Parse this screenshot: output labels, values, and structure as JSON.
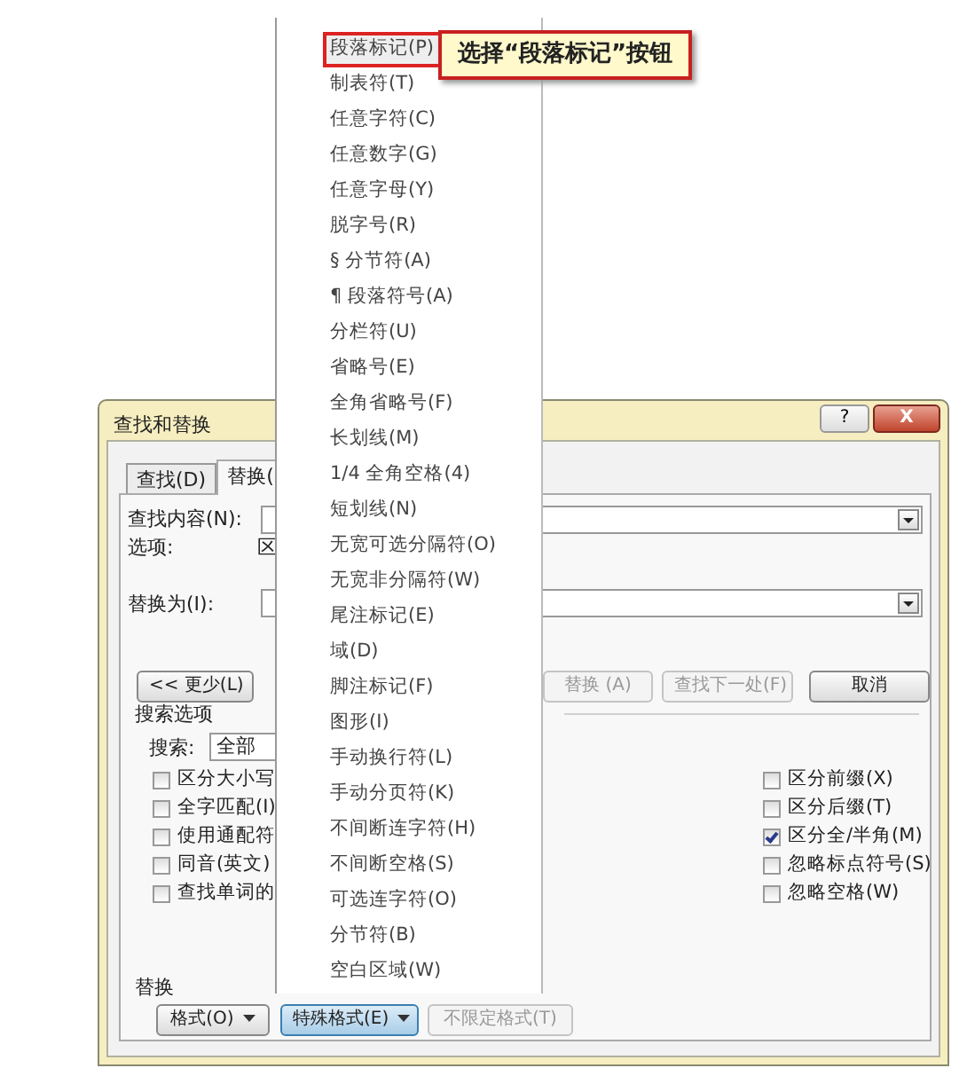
{
  "callout": {
    "text": "选择“段落标记”按钮"
  },
  "special_menu": {
    "items": [
      {
        "label": "段落标记(P)",
        "selected": true
      },
      {
        "label": "制表符(T)",
        "selected": false
      },
      {
        "label": "任意字符(C)",
        "selected": false
      },
      {
        "label": "任意数字(G)",
        "selected": false
      },
      {
        "label": "任意字母(Y)",
        "selected": false
      },
      {
        "label": "脱字号(R)",
        "selected": false
      },
      {
        "label": "§ 分节符(A)",
        "selected": false
      },
      {
        "label": "¶ 段落符号(A)",
        "selected": false
      },
      {
        "label": "分栏符(U)",
        "selected": false
      },
      {
        "label": "省略号(E)",
        "selected": false
      },
      {
        "label": "全角省略号(F)",
        "selected": false
      },
      {
        "label": "长划线(M)",
        "selected": false
      },
      {
        "label": "1/4 全角空格(4)",
        "selected": false
      },
      {
        "label": "短划线(N)",
        "selected": false
      },
      {
        "label": "无宽可选分隔符(O)",
        "selected": false
      },
      {
        "label": "无宽非分隔符(W)",
        "selected": false
      },
      {
        "label": "尾注标记(E)",
        "selected": false
      },
      {
        "label": "域(D)",
        "selected": false
      },
      {
        "label": "脚注标记(F)",
        "selected": false
      },
      {
        "label": "图形(I)",
        "selected": false
      },
      {
        "label": "手动换行符(L)",
        "selected": false
      },
      {
        "label": "手动分页符(K)",
        "selected": false
      },
      {
        "label": "不间断连字符(H)",
        "selected": false
      },
      {
        "label": "不间断空格(S)",
        "selected": false
      },
      {
        "label": "可选连字符(O)",
        "selected": false
      },
      {
        "label": "分节符(B)",
        "selected": false
      },
      {
        "label": "空白区域(W)",
        "selected": false
      }
    ]
  },
  "dialog": {
    "title": "查找和替换",
    "help_button": "?",
    "close_button": "X",
    "tabs": [
      {
        "label": "查找(D)",
        "selected": false
      },
      {
        "label": "替换(",
        "selected": true
      }
    ],
    "find_label": "查找内容(N):",
    "options_label": "选项:",
    "options_value": "区",
    "replace_label": "替换为(I):",
    "less_button": "<< 更少(L)",
    "action_buttons": [
      {
        "label": "替换 (A)",
        "disabled": true
      },
      {
        "label": "查找下一处(F)",
        "disabled": true
      },
      {
        "label": "取消",
        "disabled": false
      }
    ],
    "search_options": {
      "heading": "搜索选项",
      "search_label": "搜索:",
      "search_value": "全部",
      "left_checks": [
        {
          "label": "区分大小写",
          "checked": false
        },
        {
          "label": "全字匹配(I)",
          "checked": false
        },
        {
          "label": "使用通配符",
          "checked": false
        },
        {
          "label": "同音(英文)",
          "checked": false
        },
        {
          "label": "查找单词的",
          "checked": false
        }
      ],
      "right_checks": [
        {
          "label": "区分前缀(X)",
          "checked": false
        },
        {
          "label": "区分后缀(T)",
          "checked": false
        },
        {
          "label": "区分全/半角(M)",
          "checked": true
        },
        {
          "label": "忽略标点符号(S)",
          "checked": false
        },
        {
          "label": "忽略空格(W)",
          "checked": false
        }
      ]
    },
    "replace_section": {
      "heading": "替换",
      "buttons": [
        {
          "label": "格式(O)",
          "dropdown": true,
          "pressed": false,
          "disabled": false
        },
        {
          "label": "特殊格式(E)",
          "dropdown": true,
          "pressed": true,
          "disabled": false
        },
        {
          "label": "不限定格式(T)",
          "dropdown": false,
          "pressed": false,
          "disabled": true
        }
      ]
    }
  }
}
